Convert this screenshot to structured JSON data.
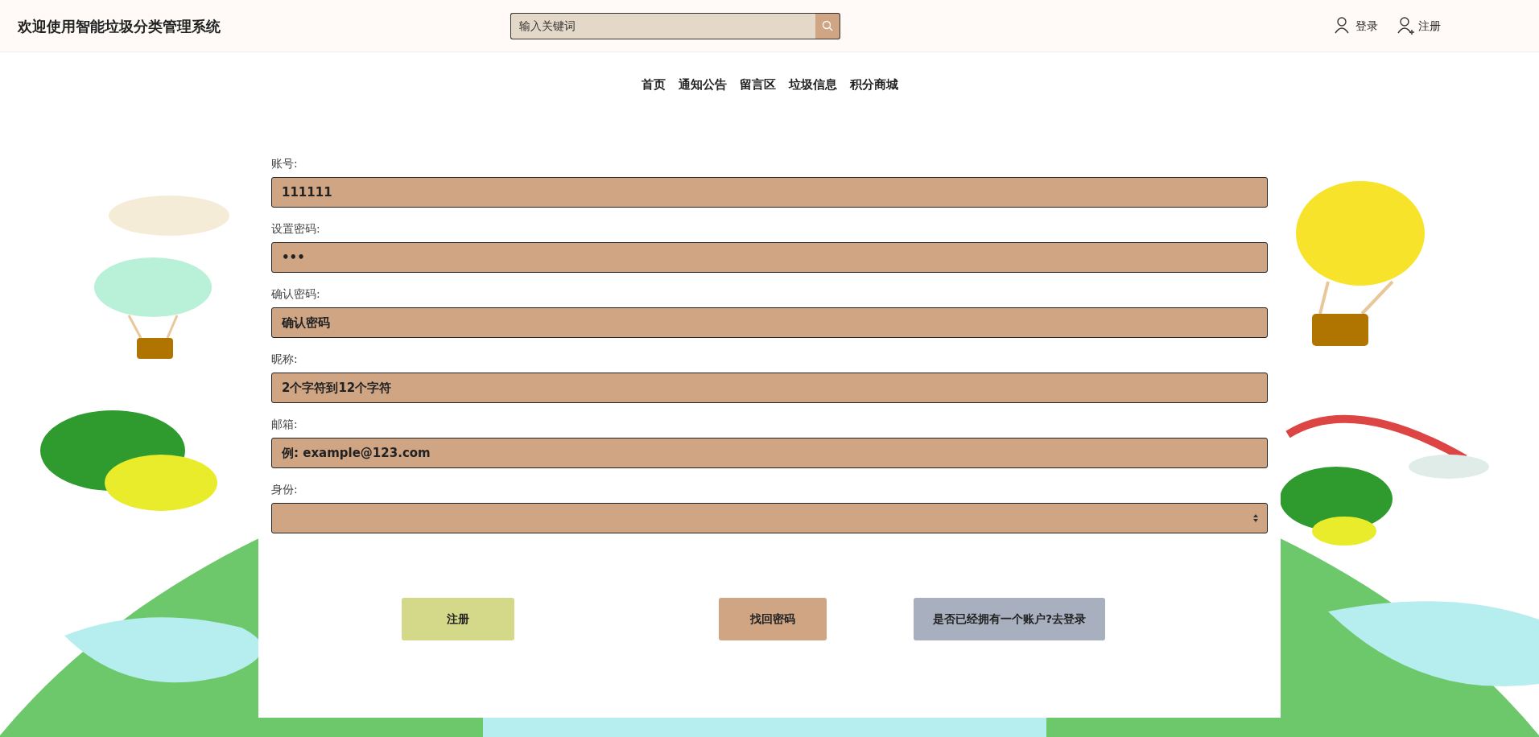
{
  "header": {
    "title": "欢迎使用智能垃圾分类管理系统",
    "search": {
      "placeholder": "输入关键词"
    },
    "links": [
      {
        "kind": "login",
        "label": "登录"
      },
      {
        "kind": "register",
        "label": "注册"
      }
    ]
  },
  "nav": [
    "首页",
    "通知公告",
    "留言区",
    "垃圾信息",
    "积分商城"
  ],
  "form": {
    "fields": [
      {
        "kind": "text",
        "label": "账号:",
        "value": "111111"
      },
      {
        "kind": "text",
        "label": "设置密码:",
        "value": "•••"
      },
      {
        "kind": "text",
        "label": "确认密码:",
        "placeholder": "确认密码"
      },
      {
        "kind": "text",
        "label": "昵称:",
        "placeholder": "2个字符到12个字符"
      },
      {
        "kind": "text",
        "label": "邮箱:",
        "placeholder": "例: example@123.com"
      },
      {
        "kind": "select",
        "label": "身份:"
      }
    ],
    "buttons": [
      {
        "kind": "register",
        "label": "注册"
      },
      {
        "kind": "recover",
        "label": "找回密码"
      },
      {
        "kind": "login",
        "label": "是否已经拥有一个账户?去登录"
      }
    ]
  }
}
